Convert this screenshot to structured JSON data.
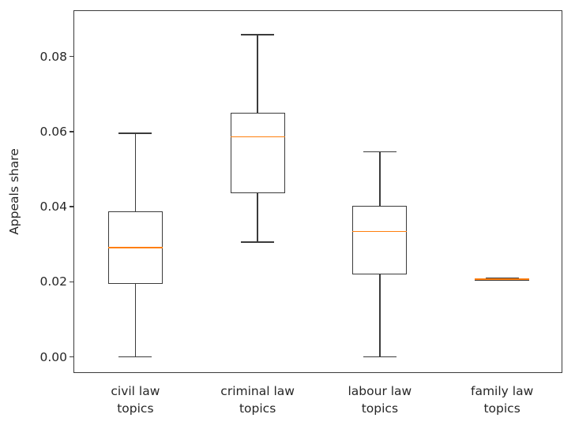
{
  "chart_data": {
    "type": "box",
    "title": "",
    "xlabel": "",
    "ylabel": "Appeals share",
    "ylim": [
      -0.0045,
      0.0921
    ],
    "ytick_labels": [
      "0.00",
      "0.02",
      "0.04",
      "0.06",
      "0.08"
    ],
    "ytick_values": [
      0.0,
      0.02,
      0.04,
      0.06,
      0.08
    ],
    "grid": false,
    "legend": null,
    "categories": [
      "civil law\ntopics",
      "criminal law\ntopics",
      "labour law\ntopics",
      "family law\ntopics"
    ],
    "boxes": [
      {
        "label": "civil law topics",
        "label_line1": "civil law",
        "label_line2": "topics",
        "whisker_low": 0.0,
        "q1": 0.0194,
        "median": 0.0291,
        "q3": 0.0388,
        "whisker_high": 0.0595
      },
      {
        "label": "criminal law topics",
        "label_line1": "criminal law",
        "label_line2": "topics",
        "whisker_low": 0.0306,
        "q1": 0.0435,
        "median": 0.0586,
        "q3": 0.065,
        "whisker_high": 0.0858
      },
      {
        "label": "labour law topics",
        "label_line1": "labour law",
        "label_line2": "topics",
        "whisker_low": 0.0,
        "q1": 0.0219,
        "median": 0.0334,
        "q3": 0.0402,
        "whisker_high": 0.0546
      },
      {
        "label": "family law topics",
        "label_line1": "family law",
        "label_line2": "topics",
        "whisker_low": 0.0204,
        "q1": 0.0206,
        "median": 0.0207,
        "q3": 0.0208,
        "whisker_high": 0.021
      }
    ],
    "colors": {
      "box_edge": "#3b3b3b",
      "median": "#ff7f0e",
      "whisker": "#3b3b3b",
      "cap": "#3b3b3b",
      "axis": "#3b3b3b",
      "text": "#262626",
      "background": "#ffffff"
    }
  }
}
